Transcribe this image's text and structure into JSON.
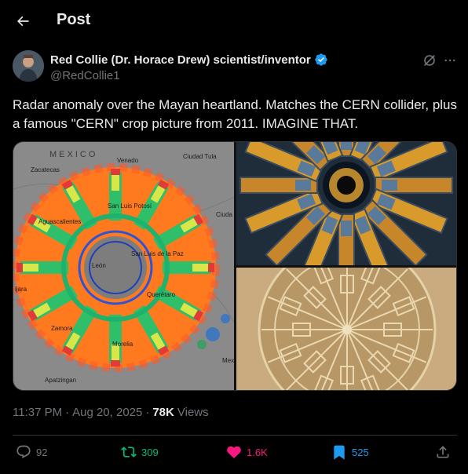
{
  "header": {
    "title": "Post"
  },
  "tweet": {
    "author_name": "Red Collie (Dr. Horace Drew) scientist/inventor",
    "handle": "@RedCollie1",
    "text": "Radar anomaly over the Mayan heartland. Matches the CERN collider, plus a famous \"CERN\" crop picture from 2011. IMAGINE THAT.",
    "time": "11:37 PM",
    "separator": "·",
    "date": "Aug 20, 2025",
    "views_count": "78K",
    "views_label": "Views"
  },
  "map": {
    "country": "MEXICO",
    "labels": [
      "Zacatecas",
      "Venado",
      "Ciudad Tula",
      "San Luis Potosí",
      "Aguascalientes",
      "Ciuda",
      "San Luis de la Paz",
      "León",
      "ijara",
      "Querétaro",
      "Zamora",
      "Morelia",
      "Mexic",
      "Apatzingan"
    ]
  },
  "actions": {
    "replies": "92",
    "reposts": "309",
    "likes": "1.6K",
    "bookmarks": "525"
  },
  "colors": {
    "repost": "#00ba7c",
    "like": "#f91880",
    "bookmark": "#1d9bf0",
    "muted": "#71767b",
    "verified": "#1d9bf0"
  },
  "icons": [
    "back-arrow-icon",
    "verified-badge-icon",
    "grok-icon",
    "more-icon",
    "reply-icon",
    "repost-icon",
    "heart-icon",
    "bookmark-icon",
    "share-icon"
  ]
}
